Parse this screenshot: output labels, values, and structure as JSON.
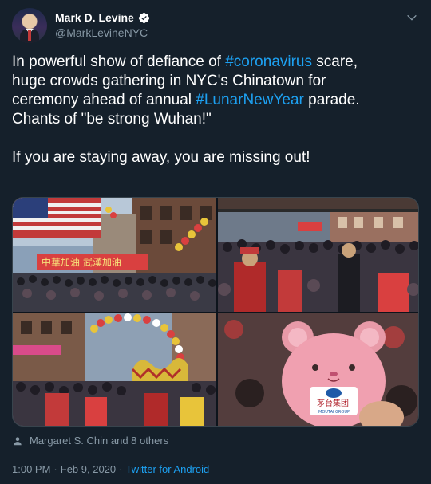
{
  "author": {
    "display_name": "Mark D. Levine",
    "handle": "@MarkLevineNYC",
    "verified": true
  },
  "tweet": {
    "line1_pre": "In powerful show of defiance of ",
    "hashtag1": "#coronavirus",
    "line1_post": " scare,",
    "line2": "huge crowds gathering in NYC's Chinatown for",
    "line3_pre": "ceremony ahead of annual ",
    "hashtag2": "#LunarNewYear",
    "line3_post": " parade.",
    "line4": "Chants of \"be strong Wuhan!\"",
    "line5": "If you are staying away, you are missing out!"
  },
  "media": {
    "photo_count": 4,
    "photo1_banner_text": "中華加油 武漢加油",
    "photo4_badge_text": "茅台集团",
    "photo4_badge_sub": "MOUTAI GROUP"
  },
  "social_context": {
    "icon": "person-icon",
    "text": "Margaret S. Chin and 8 others"
  },
  "meta": {
    "time": "1:00 PM",
    "separator1": "·",
    "date": "Feb 9, 2020",
    "separator2": "·",
    "source": "Twitter for Android"
  },
  "colors": {
    "background": "#15202b",
    "link": "#1da1f2",
    "secondary_text": "#8899a6",
    "border": "#38444d"
  }
}
